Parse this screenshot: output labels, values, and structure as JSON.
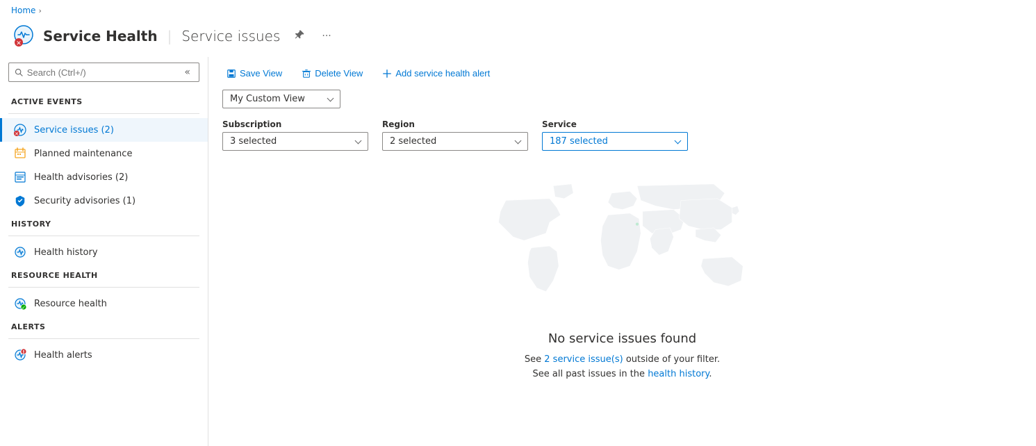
{
  "breadcrumb": {
    "home_label": "Home",
    "separator": "›"
  },
  "header": {
    "title": "Service Health",
    "divider": "|",
    "subtitle": "Service issues",
    "pin_label": "📌",
    "more_label": "···"
  },
  "sidebar": {
    "search_placeholder": "Search (Ctrl+/)",
    "collapse_icon": "«",
    "sections": [
      {
        "id": "active-events",
        "label": "ACTIVE EVENTS",
        "items": [
          {
            "id": "service-issues",
            "label": "Service issues (2)",
            "active": true
          },
          {
            "id": "planned-maintenance",
            "label": "Planned maintenance",
            "active": false
          },
          {
            "id": "health-advisories",
            "label": "Health advisories (2)",
            "active": false
          },
          {
            "id": "security-advisories",
            "label": "Security advisories (1)",
            "active": false
          }
        ]
      },
      {
        "id": "history",
        "label": "HISTORY",
        "items": [
          {
            "id": "health-history",
            "label": "Health history",
            "active": false
          }
        ]
      },
      {
        "id": "resource-health",
        "label": "RESOURCE HEALTH",
        "items": [
          {
            "id": "resource-health",
            "label": "Resource health",
            "active": false
          }
        ]
      },
      {
        "id": "alerts",
        "label": "ALERTS",
        "items": [
          {
            "id": "health-alerts",
            "label": "Health alerts",
            "active": false
          }
        ]
      }
    ]
  },
  "toolbar": {
    "save_view_label": "Save View",
    "delete_view_label": "Delete View",
    "add_alert_label": "Add service health alert"
  },
  "view_dropdown": {
    "label": "My Custom View"
  },
  "filters": {
    "subscription": {
      "label": "Subscription",
      "value": "3 selected"
    },
    "region": {
      "label": "Region",
      "value": "2 selected"
    },
    "service": {
      "label": "Service",
      "value": "187 selected"
    }
  },
  "empty_state": {
    "title": "No service issues found",
    "line1_prefix": "See ",
    "line1_link": "2 service issue(s)",
    "line1_suffix": " outside of your filter.",
    "line2_prefix": "See all past issues in the ",
    "line2_link": "health history",
    "line2_suffix": "."
  }
}
